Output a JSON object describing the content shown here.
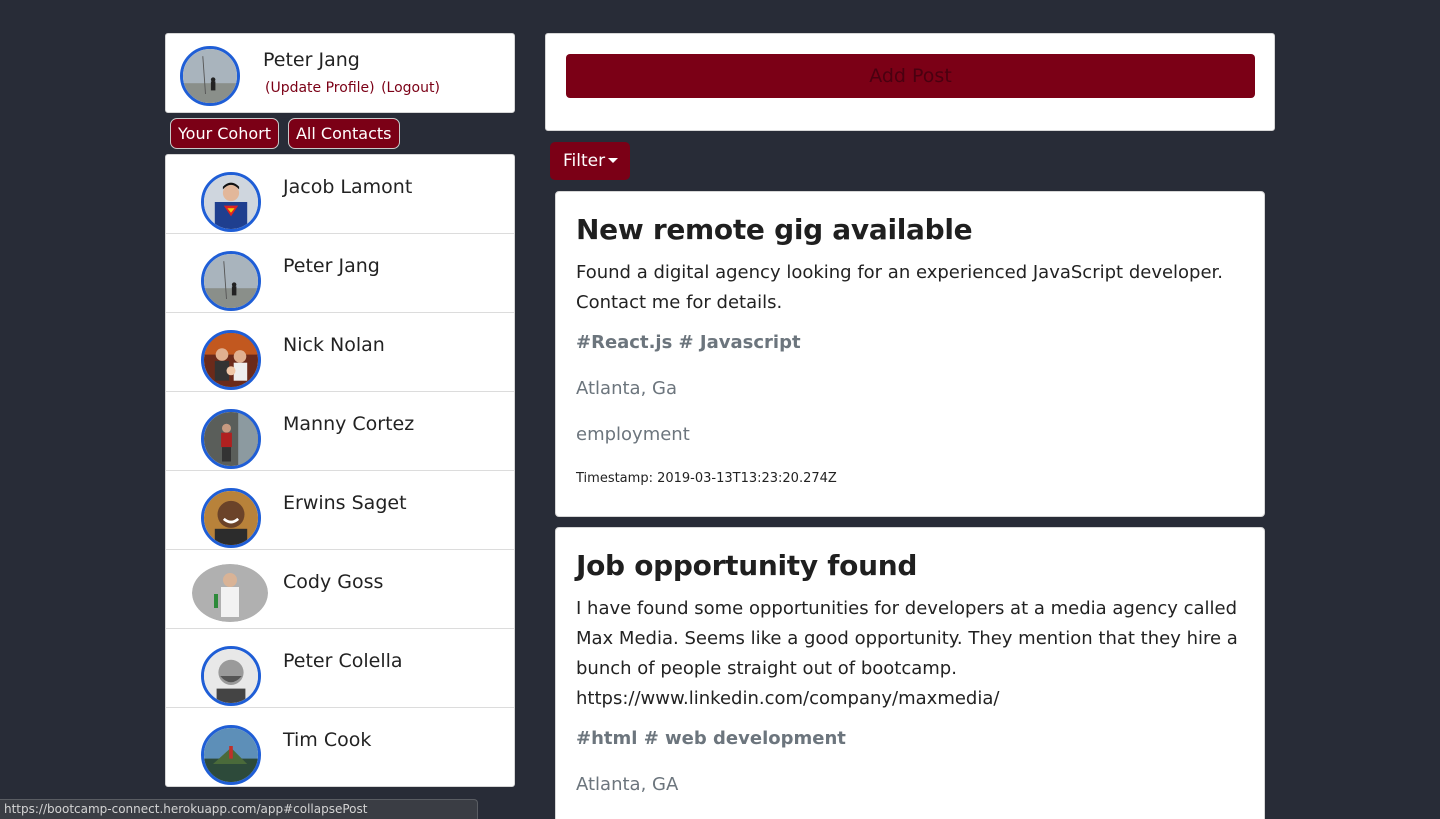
{
  "profile": {
    "name": "Peter Jang",
    "update_label": "(Update Profile)",
    "logout_label": "(Logout)"
  },
  "tabs": {
    "cohort_label": "Your Cohort",
    "all_contacts_label": "All Contacts"
  },
  "contacts": [
    {
      "name": "Jacob Lamont"
    },
    {
      "name": "Peter Jang"
    },
    {
      "name": "Nick Nolan"
    },
    {
      "name": "Manny Cortez"
    },
    {
      "name": "Erwins Saget"
    },
    {
      "name": "Cody Goss"
    },
    {
      "name": "Peter Colella"
    },
    {
      "name": "Tim Cook"
    }
  ],
  "actions": {
    "add_post_label": "Add Post",
    "filter_label": "Filter"
  },
  "posts": [
    {
      "title": "New remote gig available",
      "body": "Found a digital agency looking for an experienced JavaScript developer. Contact me for details.",
      "tags": "#React.js # Javascript",
      "location": "Atlanta, Ga",
      "category": "employment",
      "timestamp": "Timestamp: 2019-03-13T13:23:20.274Z"
    },
    {
      "title": "Job opportunity found",
      "body": "I have found some opportunities for developers at a media agency called Max Media. Seems like a good opportunity. They mention that they hire a bunch of people straight out of bootcamp. https://www.linkedin.com/company/maxmedia/",
      "tags": "#html # web development",
      "location": "Atlanta, GA"
    }
  ],
  "status_bar": {
    "url": "https://bootcamp-connect.herokuapp.com/app#collapsePost"
  },
  "colors": {
    "background": "#282c37",
    "accent": "#7b0016",
    "avatar_ring": "#1f5ed6",
    "muted_text": "#6c757d"
  }
}
